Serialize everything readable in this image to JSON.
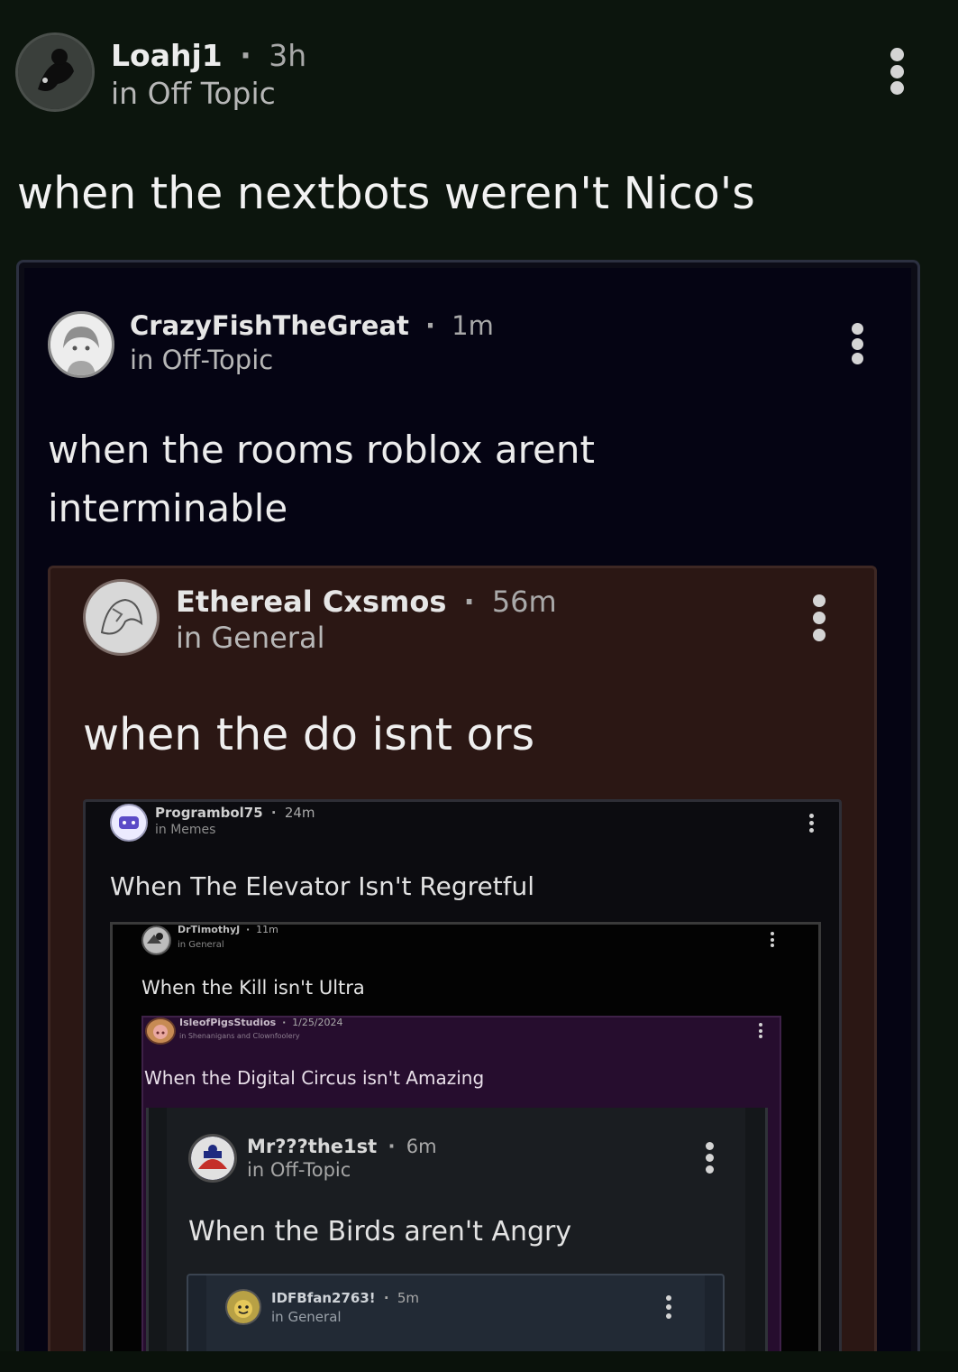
{
  "post": {
    "username": "Loahj1",
    "time": "3h",
    "channel": "in Off Topic",
    "avatar_icon": "silhouette-avatar-icon",
    "title": "when the nextbots weren't Nico's"
  },
  "quotes": [
    {
      "username": "CrazyFishTheGreat",
      "time": "1m",
      "channel": "in Off-Topic",
      "title_line1": "when the rooms roblox arent",
      "title_line2": "interminable",
      "background": "#050413"
    },
    {
      "username": "Ethereal Cxsmos",
      "time": "56m",
      "channel": "in General",
      "title": "when the do isnt ors",
      "background": "#2b1714"
    },
    {
      "username": "Programbol75",
      "time": "24m",
      "channel": "in Memes",
      "title": "When The Elevator Isn't Regretful",
      "background": "#0c0c10"
    },
    {
      "username": "DrTimothyJ",
      "time": "11m",
      "channel": "in General",
      "title": "When the Kill isn't Ultra",
      "background": "#030303"
    },
    {
      "username": "IsleofPigsStudios",
      "time": "1/25/2024",
      "channel": "in Shenanigans and Clownfoolery",
      "title": "When the Digital Circus isn't Amazing",
      "background": "#260d2e"
    },
    {
      "username": "Mr???the1st",
      "time": "6m",
      "channel": "in Off-Topic",
      "title": "When the Birds aren't Angry",
      "background": "#1a1d21"
    },
    {
      "username": "IDFBfan2763!",
      "time": "5m",
      "channel": "in General",
      "background": "#222a35"
    }
  ],
  "separator": "·"
}
